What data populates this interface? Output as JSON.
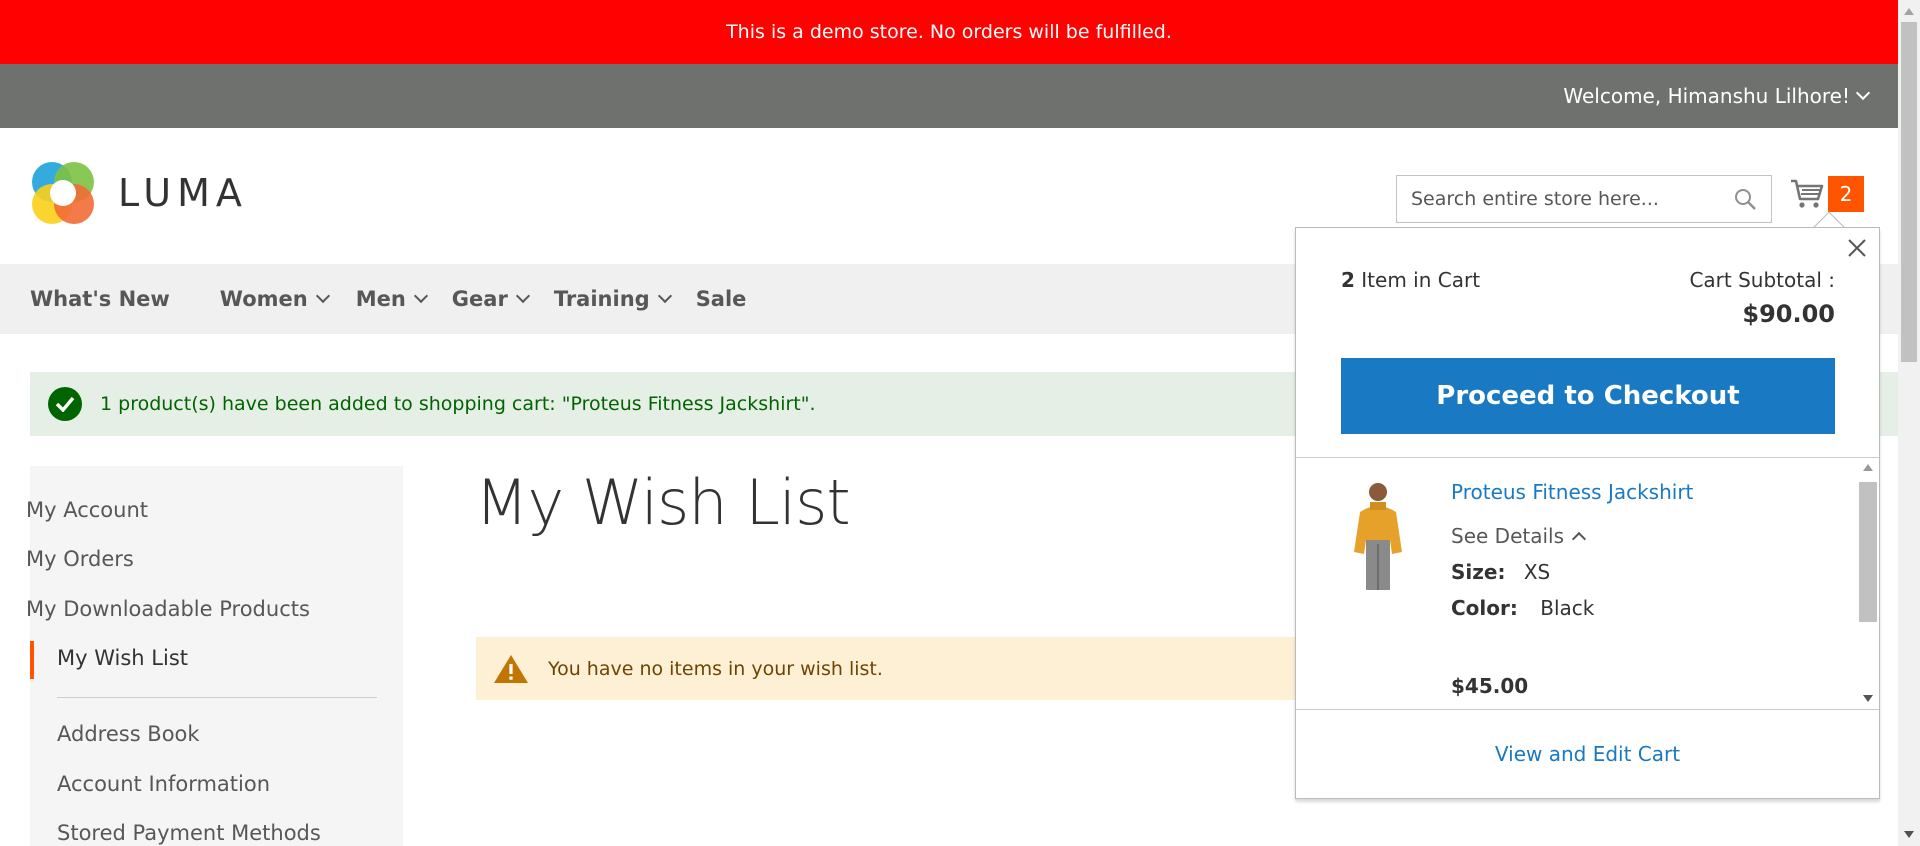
{
  "demo_notice": "This is a demo store. No orders will be fulfilled.",
  "header": {
    "welcome": "Welcome, Himanshu Lilhore!",
    "logo_text": "LUMA",
    "search_placeholder": "Search entire store here...",
    "cart_count": "2"
  },
  "nav": {
    "items": [
      {
        "label": "What's New",
        "has_dropdown": false
      },
      {
        "label": "Women",
        "has_dropdown": true
      },
      {
        "label": "Men",
        "has_dropdown": true
      },
      {
        "label": "Gear",
        "has_dropdown": true
      },
      {
        "label": "Training",
        "has_dropdown": true
      },
      {
        "label": "Sale",
        "has_dropdown": false
      }
    ]
  },
  "messages": {
    "success": "1 product(s) have been added to shopping cart: \"Proteus Fitness Jackshirt\".",
    "wishlist_empty": "You have no items in your wish list."
  },
  "sidebar": {
    "items": [
      {
        "label": "My Account"
      },
      {
        "label": "My Orders"
      },
      {
        "label": "My Downloadable Products"
      },
      {
        "label": "My Wish List",
        "active": true
      },
      {
        "label": "Address Book"
      },
      {
        "label": "Account Information"
      },
      {
        "label": "Stored Payment Methods"
      }
    ]
  },
  "main": {
    "title": "My Wish List"
  },
  "minicart": {
    "count_number": "2",
    "count_label": "Item in Cart",
    "subtotal_label": "Cart Subtotal :",
    "subtotal": "$90.00",
    "checkout_label": "Proceed to Checkout",
    "item": {
      "name": "Proteus Fitness Jackshirt",
      "see_details": "See Details",
      "size_label": "Size:",
      "size_value": "XS",
      "color_label": "Color:",
      "color_value": "Black",
      "price": "$45.00"
    },
    "view_edit_label": "View and Edit Cart"
  },
  "colors": {
    "demo_bar": "#ff0101",
    "accent_orange": "#ff5501",
    "link_blue": "#1979c3",
    "success_green": "#006400"
  }
}
